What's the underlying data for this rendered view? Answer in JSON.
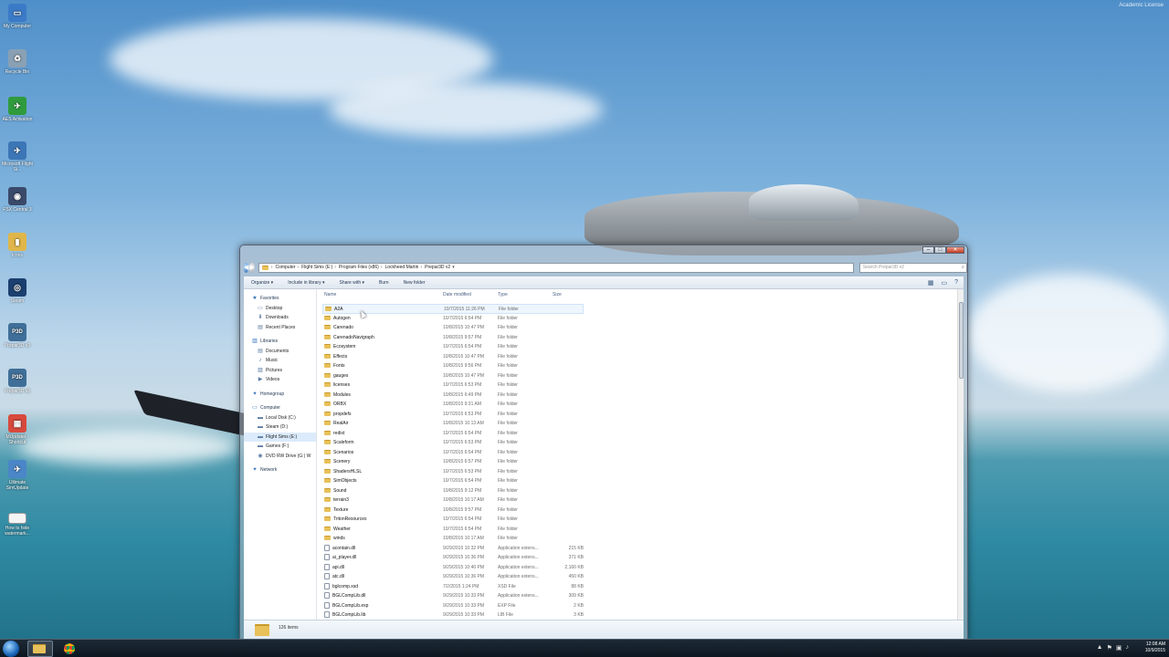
{
  "desktop": {
    "watermark": "Academic License",
    "icons": [
      {
        "label": "My Computer",
        "icon": "computer-icon",
        "color": "#3b7ac7",
        "glyph": "▭"
      },
      {
        "label": "Recycle Bin",
        "icon": "recycle-bin-icon",
        "color": "#8aa0b4",
        "glyph": "♻"
      },
      {
        "label": "AES Activation",
        "icon": "aes-icon",
        "color": "#2f9b3d",
        "glyph": "✈"
      },
      {
        "label": "Microsoft Flight Si...",
        "icon": "fsx-icon",
        "color": "#3d76b6",
        "glyph": "✈"
      },
      {
        "label": "FSX Central 3",
        "icon": "fsx-central-icon",
        "color": "#3a4a6a",
        "glyph": "◉"
      },
      {
        "label": "Icons",
        "icon": "folder-icon",
        "color": "#e0b64a",
        "glyph": "▮"
      },
      {
        "label": "Steam",
        "icon": "steam-icon",
        "color": "#1b3f6e",
        "glyph": "◎"
      },
      {
        "label": "Prepar3D v3",
        "icon": "p3d-icon",
        "color": "#3f6f98",
        "glyph": "P3D"
      },
      {
        "label": "Prepar3D v2",
        "icon": "p3d-icon",
        "color": "#3f6f98",
        "glyph": "P3D"
      },
      {
        "label": "MUpdater - Shortcut",
        "icon": "mupdater-icon",
        "color": "#d7493d",
        "glyph": "▦"
      },
      {
        "label": "Ultimate SimUpdate",
        "icon": "simupdate-icon",
        "color": "#4a86c8",
        "glyph": "✈"
      },
      {
        "label": "How to hide watermark...",
        "icon": "text-file-icon",
        "color": "#f4f4f4",
        "glyph": ""
      }
    ]
  },
  "taskbar": {
    "time": "12:08 AM",
    "date": "10/9/2015",
    "tray_icons": [
      "▲",
      "⚑",
      "▣",
      "♪"
    ]
  },
  "window": {
    "caption_buttons": {
      "minimize": "–",
      "maximize": "□",
      "close": "✕"
    },
    "back": "◀",
    "forward": "▶",
    "breadcrumbs": [
      "Computer",
      "Flight Sims (E:)",
      "Program Files (x86)",
      "Lockheed Martin",
      "Prepar3D v2"
    ],
    "search_placeholder": "Search Prepar3D v2",
    "toolbar": {
      "organize": "Organize ▾",
      "include": "Include in library ▾",
      "share": "Share with ▾",
      "burn": "Burn",
      "new_folder": "New folder"
    },
    "columns": {
      "name": "Name",
      "date": "Date modified",
      "type": "Type",
      "size": "Size"
    },
    "nav": [
      {
        "label": "Favorites",
        "kind": "hdr",
        "glyph": "★"
      },
      {
        "label": "Desktop",
        "kind": "sub",
        "glyph": "▭"
      },
      {
        "label": "Downloads",
        "kind": "sub",
        "glyph": "⬇"
      },
      {
        "label": "Recent Places",
        "kind": "sub",
        "glyph": "▤"
      },
      {
        "gap": true
      },
      {
        "label": "Libraries",
        "kind": "hdr",
        "glyph": "▥"
      },
      {
        "label": "Documents",
        "kind": "sub",
        "glyph": "▤"
      },
      {
        "label": "Music",
        "kind": "sub",
        "glyph": "♪"
      },
      {
        "label": "Pictures",
        "kind": "sub",
        "glyph": "▨"
      },
      {
        "label": "Videos",
        "kind": "sub",
        "glyph": "▶"
      },
      {
        "gap": true
      },
      {
        "label": "Homegroup",
        "kind": "hdr",
        "glyph": "✦"
      },
      {
        "gap": true
      },
      {
        "label": "Computer",
        "kind": "hdr",
        "glyph": "▭"
      },
      {
        "label": "Local Disk (C:)",
        "kind": "sub",
        "glyph": "▬"
      },
      {
        "label": "Steam (D:)",
        "kind": "sub",
        "glyph": "▬"
      },
      {
        "label": "Flight Sims (E:)",
        "kind": "sub sel",
        "glyph": "▬"
      },
      {
        "label": "Games (F:)",
        "kind": "sub",
        "glyph": "▬"
      },
      {
        "label": "DVD RW Drive (G:) W",
        "kind": "sub",
        "glyph": "◉"
      },
      {
        "gap": true
      },
      {
        "label": "Network",
        "kind": "hdr",
        "glyph": "✦"
      }
    ],
    "files": [
      {
        "name": "A2A",
        "date": "10/7/2015 11:26 PM",
        "type": "File folder",
        "size": "",
        "kind": "folder"
      },
      {
        "name": "Autogen",
        "date": "10/7/2015 6:54 PM",
        "type": "File folder",
        "size": "",
        "kind": "folder"
      },
      {
        "name": "Carenado",
        "date": "10/8/2015 10:47 PM",
        "type": "File folder",
        "size": "",
        "kind": "folder"
      },
      {
        "name": "CarenadoNavigraph",
        "date": "10/8/2015 9:57 PM",
        "type": "File folder",
        "size": "",
        "kind": "folder"
      },
      {
        "name": "Ecosystem",
        "date": "10/7/2015 6:54 PM",
        "type": "File folder",
        "size": "",
        "kind": "folder"
      },
      {
        "name": "Effects",
        "date": "10/8/2015 10:47 PM",
        "type": "File folder",
        "size": "",
        "kind": "folder"
      },
      {
        "name": "Fonts",
        "date": "10/8/2015 9:56 PM",
        "type": "File folder",
        "size": "",
        "kind": "folder"
      },
      {
        "name": "gauges",
        "date": "10/8/2015 10:47 PM",
        "type": "File folder",
        "size": "",
        "kind": "folder"
      },
      {
        "name": "licenses",
        "date": "10/7/2015 6:53 PM",
        "type": "File folder",
        "size": "",
        "kind": "folder"
      },
      {
        "name": "Modules",
        "date": "10/8/2015 6:49 PM",
        "type": "File folder",
        "size": "",
        "kind": "folder"
      },
      {
        "name": "ORBX",
        "date": "10/8/2015 9:31 AM",
        "type": "File folder",
        "size": "",
        "kind": "folder"
      },
      {
        "name": "propdefs",
        "date": "10/7/2015 6:53 PM",
        "type": "File folder",
        "size": "",
        "kind": "folder"
      },
      {
        "name": "RealAir",
        "date": "10/8/2015 10:13 AM",
        "type": "File folder",
        "size": "",
        "kind": "folder"
      },
      {
        "name": "redist",
        "date": "10/7/2015 6:54 PM",
        "type": "File folder",
        "size": "",
        "kind": "folder"
      },
      {
        "name": "Scaleform",
        "date": "10/7/2015 6:53 PM",
        "type": "File folder",
        "size": "",
        "kind": "folder"
      },
      {
        "name": "Scenarios",
        "date": "10/7/2015 6:54 PM",
        "type": "File folder",
        "size": "",
        "kind": "folder"
      },
      {
        "name": "Scenery",
        "date": "10/8/2015 6:57 PM",
        "type": "File folder",
        "size": "",
        "kind": "folder"
      },
      {
        "name": "ShadersHLSL",
        "date": "10/7/2015 6:53 PM",
        "type": "File folder",
        "size": "",
        "kind": "folder"
      },
      {
        "name": "SimObjects",
        "date": "10/7/2015 6:54 PM",
        "type": "File folder",
        "size": "",
        "kind": "folder"
      },
      {
        "name": "Sound",
        "date": "10/8/2015 9:12 PM",
        "type": "File folder",
        "size": "",
        "kind": "folder"
      },
      {
        "name": "terrain3",
        "date": "10/8/2015 10:17 AM",
        "type": "File folder",
        "size": "",
        "kind": "folder"
      },
      {
        "name": "Texture",
        "date": "10/8/2015 9:57 PM",
        "type": "File folder",
        "size": "",
        "kind": "folder"
      },
      {
        "name": "TritonResources",
        "date": "10/7/2015 6:54 PM",
        "type": "File folder",
        "size": "",
        "kind": "folder"
      },
      {
        "name": "Weather",
        "date": "10/7/2015 6:54 PM",
        "type": "File folder",
        "size": "",
        "kind": "folder"
      },
      {
        "name": "winds",
        "date": "10/8/2015 10:17 AM",
        "type": "File folder",
        "size": "",
        "kind": "folder"
      },
      {
        "name": "acontain.dll",
        "date": "9/29/2015 10:32 PM",
        "type": "Application extens...",
        "size": "215 KB",
        "kind": "file"
      },
      {
        "name": "ai_player.dll",
        "date": "9/29/2015 10:36 PM",
        "type": "Application extens...",
        "size": "371 KB",
        "kind": "file"
      },
      {
        "name": "api.dll",
        "date": "9/29/2015 10:40 PM",
        "type": "Application extens...",
        "size": "2,160 KB",
        "kind": "file"
      },
      {
        "name": "atc.dll",
        "date": "9/29/2015 10:36 PM",
        "type": "Application extens...",
        "size": "450 KB",
        "kind": "file"
      },
      {
        "name": "bglcomp.xsd",
        "date": "7/2/2015 1:24 PM",
        "type": "XSD File",
        "size": "88 KB",
        "kind": "file"
      },
      {
        "name": "BGLCompLib.dll",
        "date": "9/29/2015 10:33 PM",
        "type": "Application extens...",
        "size": "309 KB",
        "kind": "file"
      },
      {
        "name": "BGLCompLib.exp",
        "date": "9/29/2015 10:33 PM",
        "type": "EXP File",
        "size": "2 KB",
        "kind": "file"
      },
      {
        "name": "BGLCompLib.lib",
        "date": "9/29/2015 10:33 PM",
        "type": "LIB File",
        "size": "3 KB",
        "kind": "file"
      }
    ],
    "status": "126 items"
  }
}
